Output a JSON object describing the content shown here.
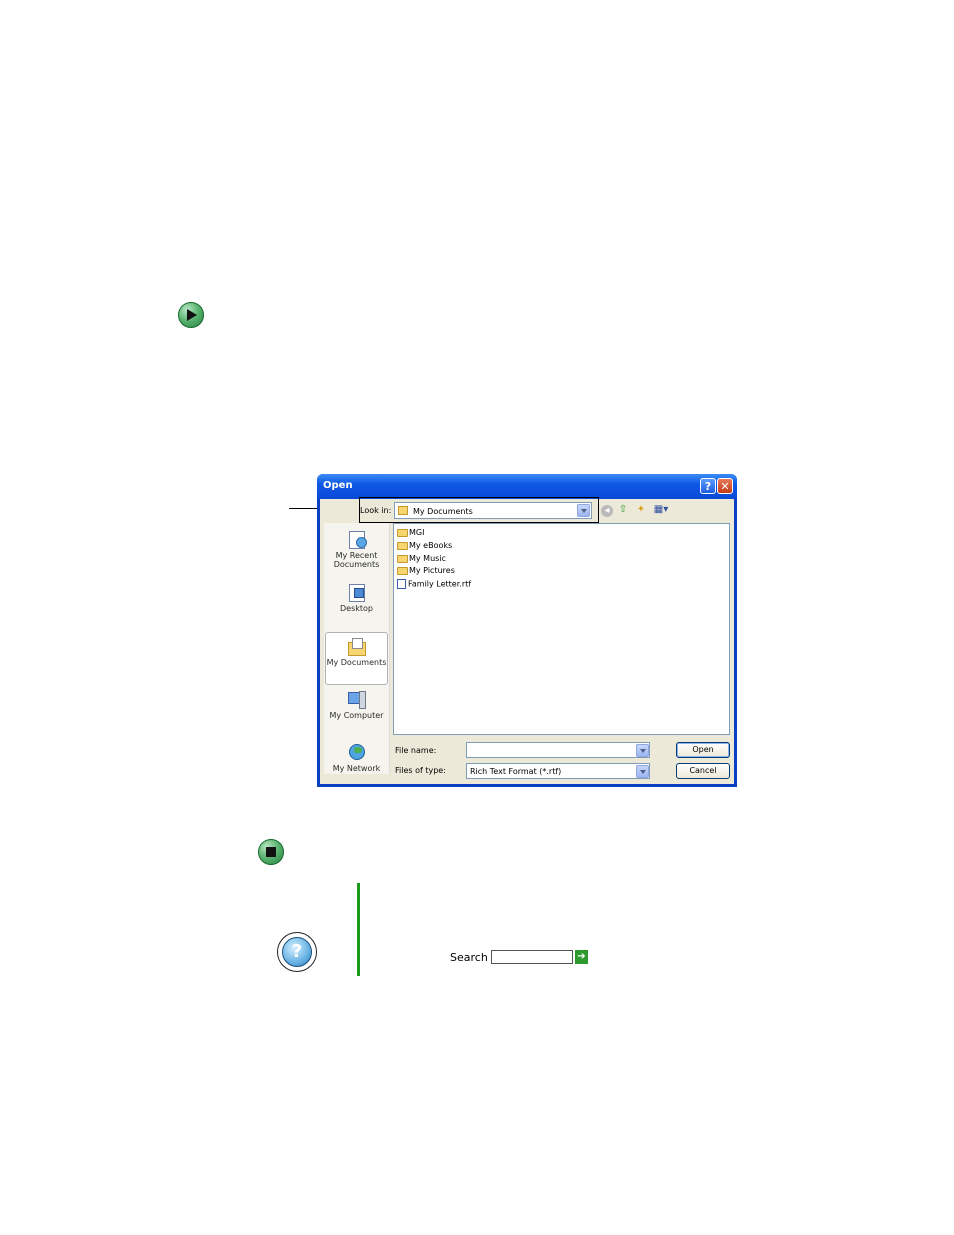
{
  "markers": {
    "start_icon": "play-arrow-icon",
    "stop_icon": "stop-square-icon"
  },
  "dialog": {
    "title": "Open",
    "help_glyph": "?",
    "close_glyph": "✕",
    "look_in": {
      "label": "Look in:",
      "value": "My Documents"
    },
    "toolbar": [
      "back-icon",
      "up-folder-icon",
      "new-folder-icon",
      "views-menu-icon"
    ],
    "places": [
      {
        "label_line1": "My Recent",
        "label_line2": "Documents",
        "icon": "recent-documents-icon"
      },
      {
        "label_line1": "Desktop",
        "label_line2": "",
        "icon": "desktop-icon"
      },
      {
        "label_line1": "My Documents",
        "label_line2": "",
        "icon": "my-documents-icon"
      },
      {
        "label_line1": "My Computer",
        "label_line2": "",
        "icon": "my-computer-icon"
      },
      {
        "label_line1": "My Network",
        "label_line2": "",
        "icon": "my-network-icon"
      }
    ],
    "files": [
      {
        "name": "MGI",
        "type": "folder"
      },
      {
        "name": "My eBooks",
        "type": "folder"
      },
      {
        "name": "My Music",
        "type": "folder"
      },
      {
        "name": "My Pictures",
        "type": "folder"
      },
      {
        "name": "Family Letter.rtf",
        "type": "rtf"
      }
    ],
    "file_name": {
      "label": "File name:",
      "value": ""
    },
    "files_of_type": {
      "label": "Files of type:",
      "value": "Rich Text Format (*.rtf)"
    },
    "open_label": "Open",
    "cancel_label": "Cancel"
  },
  "help": {
    "icon": "help-question-icon",
    "glyph": "?",
    "search_label": "Search",
    "search_value": "",
    "go_glyph": "➔"
  },
  "colors": {
    "titlebar": "#0a48d6",
    "dialog_bg": "#ece9d8",
    "accent_green": "#1a9a1a"
  }
}
